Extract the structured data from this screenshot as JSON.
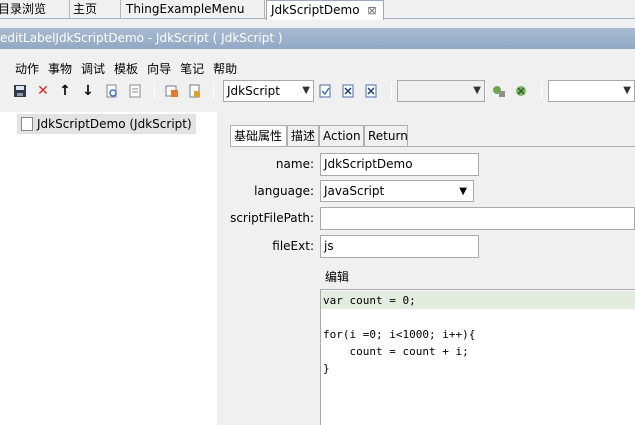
{
  "tabs": [
    {
      "label": "目录浏览"
    },
    {
      "label": "主页"
    },
    {
      "label": "ThingExampleMenu"
    },
    {
      "label": "JdkScriptDemo",
      "close": "⊠"
    }
  ],
  "window_title": "editLabelJdkScriptDemo - JdkScript ( JdkScript )",
  "menu": [
    "动作",
    "事物",
    "调试",
    "模板",
    "向导",
    "笔记",
    "帮助"
  ],
  "toolbar": {
    "icons": [
      "save-icon",
      "delete-icon",
      "arrow-up-icon",
      "arrow-down-icon",
      "search-doc-icon",
      "document-icon",
      "open-icon",
      "lock-icon",
      "doc-edit-icon",
      "close-doc-icon",
      "close-doc-icon-2",
      "run-icon",
      "stop-icon"
    ],
    "type_combo": "JdkScript",
    "second_combo": "",
    "third_combo": ""
  },
  "tree": {
    "node_label": "JdkScriptDemo (JdkScript)"
  },
  "subtabs": [
    "基础属性",
    "描述",
    "Action",
    "Return"
  ],
  "form": {
    "name_label": "name:",
    "name_value": "JdkScriptDemo",
    "language_label": "language:",
    "language_value": "JavaScript",
    "scriptFilePath_label": "scriptFilePath:",
    "scriptFilePath_value": "",
    "fileExt_label": "fileExt:",
    "fileExt_value": "js"
  },
  "editor": {
    "group_title": "编辑",
    "lines": [
      "var count = 0;",
      "",
      "for(i =0; i<1000; i++){",
      "    count = count + i;",
      "}"
    ]
  },
  "colors": {
    "titlebar": "#9fb2cb",
    "code_highlight": "#e3ecdf"
  }
}
